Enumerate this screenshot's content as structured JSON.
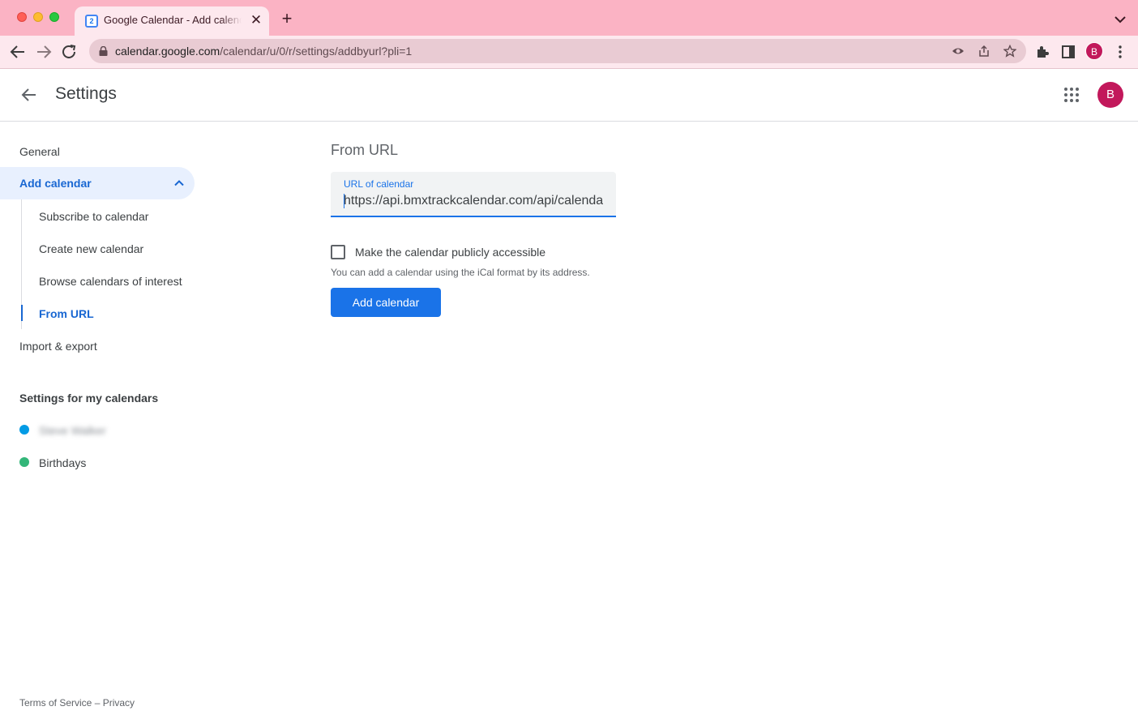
{
  "browser": {
    "tab_title": "Google Calendar - Add calendar",
    "tab_favicon_text": "2",
    "url_host": "calendar.google.com",
    "url_path": "/calendar/u/0/r/settings/addbyurl?pli=1",
    "profile_initial": "B",
    "theme_color": "#fbb3c4"
  },
  "header": {
    "title": "Settings",
    "avatar_initial": "B"
  },
  "sidebar": {
    "general": "General",
    "add_calendar": "Add calendar",
    "subitems": [
      "Subscribe to calendar",
      "Create new calendar",
      "Browse calendars of interest",
      "From URL"
    ],
    "import_export": "Import & export",
    "my_calendars_title": "Settings for my calendars",
    "calendars": [
      {
        "name": "Steve Walker",
        "color": "#039be5"
      },
      {
        "name": "Birthdays",
        "color": "#33b679"
      }
    ]
  },
  "main": {
    "heading": "From URL",
    "field_label": "URL of calendar",
    "field_value": "https://api.bmxtrackcalendar.com/api/calendar",
    "checkbox_label": "Make the calendar publicly accessible",
    "hint": "You can add a calendar using the iCal format by its address.",
    "button_label": "Add calendar"
  },
  "footer": {
    "terms": "Terms of Service",
    "separator": " – ",
    "privacy": "Privacy"
  }
}
